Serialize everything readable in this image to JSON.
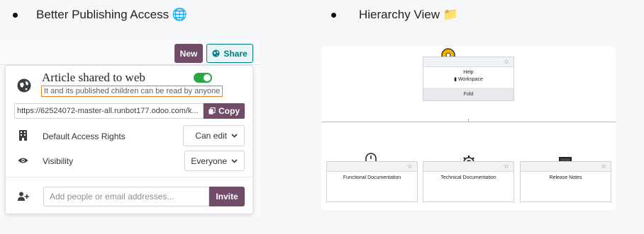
{
  "headings": {
    "left": "Better Publishing Access",
    "right": "Hierarchy View",
    "left_icon": "globe-icon",
    "right_icon": "folder-icon"
  },
  "share_panel": {
    "new_button": "New",
    "share_button": "Share",
    "title": "Article shared to web",
    "subtitle": "It and its published children can be read by anyone",
    "url": "https://62524072-master-all.runbot177.odoo.com/k...",
    "copy_button": "Copy",
    "default_access_label": "Default Access Rights",
    "default_access_value": "Can edit",
    "visibility_label": "Visibility",
    "visibility_value": "Everyone",
    "invite_placeholder": "Add people or email addresses...",
    "invite_button": "Invite",
    "toggle_on": true
  },
  "hierarchy": {
    "root": {
      "title": "Help",
      "subtitle": "Workspace",
      "footer": "Fold",
      "icon": "key-icon"
    },
    "children": [
      {
        "title": "Functional Documentation",
        "icon": "mouse-icon"
      },
      {
        "title": "Technical Documentation",
        "icon": "gear-icon"
      },
      {
        "title": "Release Notes",
        "icon": "laptop-icon"
      }
    ],
    "star": "☆"
  },
  "colors": {
    "primary": "#714b67",
    "teal": "#017e84",
    "toggle": "#28a745",
    "highlight": "#e67e22"
  }
}
